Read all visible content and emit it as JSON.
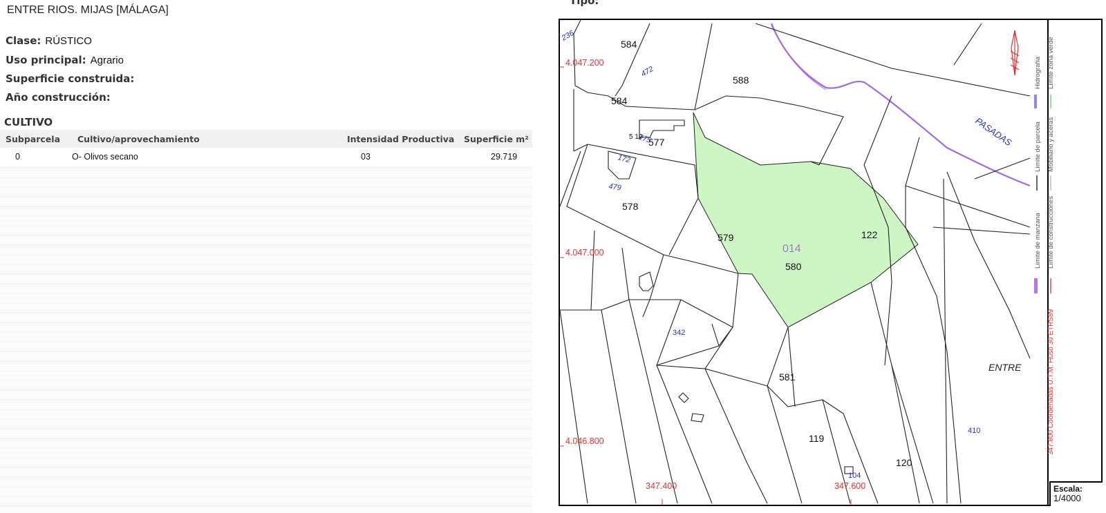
{
  "location": "ENTRE RIOS. MIJAS [MÁLAGA]",
  "properties": [
    {
      "label": "Clase:",
      "value": "RÚSTICO"
    },
    {
      "label": "Uso principal:",
      "value": "Agrario"
    },
    {
      "label": "Superficie construida:",
      "value": ""
    },
    {
      "label": "Año construcción:",
      "value": ""
    }
  ],
  "cultivo": {
    "title": "CULTIVO",
    "headers": [
      "Subparcela",
      "Cultivo/aprovechamiento",
      "Intensidad Productiva",
      "Superficie m²"
    ],
    "rows": [
      [
        "0",
        "O- Olivos secano",
        "03",
        "29.719"
      ]
    ]
  },
  "map": {
    "title": "Tipo:",
    "highlight_color": "#cef5c4",
    "polygon_label": "014",
    "parcels": [
      "584",
      "588",
      "584",
      "577",
      "578",
      "579",
      "580",
      "581",
      "122",
      "119",
      "120",
      "5 19"
    ],
    "blue_labels": [
      "236",
      "472",
      "275",
      "172",
      "479",
      "342",
      "410",
      "104"
    ],
    "road_label": "PASADAS",
    "place_label": "ENTRE",
    "coords_y": [
      "4.047.200",
      "4.047.000",
      "4.046.800"
    ],
    "coords_x": [
      "347.400",
      "347.600"
    ],
    "side_note": "347.800 Coordenadas U.T.M. Huso 30 ETRS89",
    "legend": {
      "limite_manzana": "Límite de manzana",
      "limite_construcciones": "Límite de construcciones",
      "limite_parcela": "Límite de parcela",
      "mobiliario": "Mobiliario y aceras",
      "hidrografia": "Hidrografía",
      "zona_verde": "Límite zona verde"
    },
    "legend_colors": {
      "manzana": "#b07be0",
      "construcciones": "#e04040",
      "parcela": "#333333",
      "mobiliario": "#bbbbbb",
      "hidrografia": "#8888ee",
      "zona_verde": "#77d08a"
    },
    "scale_label": "Escala:",
    "scale_value": "1/4000"
  }
}
